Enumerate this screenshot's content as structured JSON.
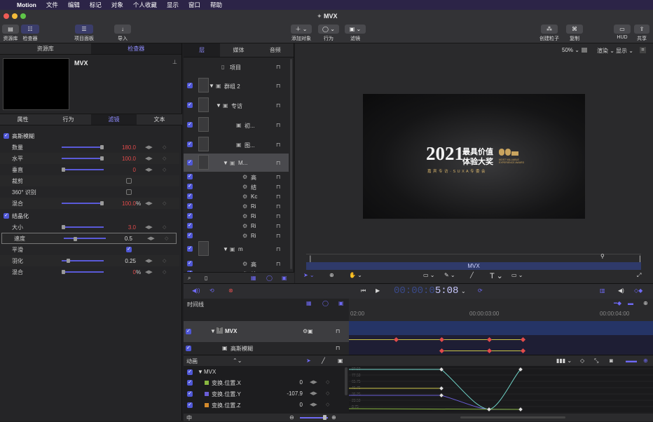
{
  "menubar": {
    "apple": "",
    "app": "Motion",
    "items": [
      "文件",
      "编辑",
      "标记",
      "对象",
      "个人收藏",
      "显示",
      "窗口",
      "帮助"
    ]
  },
  "window": {
    "title": "MVX"
  },
  "toolbar": {
    "library": "资源库",
    "inspector": "检查器",
    "project_panel": "项目面板",
    "import": "导入",
    "add_object": "添加对象",
    "behaviors": "行为",
    "filters": "滤镜",
    "make_particles": "创建粒子",
    "replicate": "复制",
    "hud": "HUD",
    "share": "共享"
  },
  "left_tabs": {
    "library": "资源库",
    "inspector": "检查器"
  },
  "inspector": {
    "preview_title": "MVX",
    "tabs": [
      "属性",
      "行为",
      "滤镜",
      "文本"
    ],
    "blur_section": "高斯模糊",
    "blur_params": [
      {
        "label": "数量",
        "value": "180.0",
        "unit": "",
        "fill": 0.97
      },
      {
        "label": "水平",
        "value": "100.0",
        "unit": "",
        "fill": 0.97
      },
      {
        "label": "垂直",
        "value": "0",
        "unit": "",
        "fill": 0.0
      },
      {
        "label": "裁剪",
        "value": "",
        "unit": ""
      },
      {
        "label": "360° 识别",
        "value": "",
        "unit": ""
      },
      {
        "label": "混合",
        "value": "100.0",
        "unit": "%",
        "fill": 0.97
      }
    ],
    "crystal_section": "结晶化",
    "crystal_params": [
      {
        "label": "大小",
        "value": "3.0",
        "unit": "",
        "fill": 0.0
      },
      {
        "label": "速度",
        "value": "0.5",
        "unit": "",
        "fill": 0.25
      },
      {
        "label": "平滑",
        "value": "",
        "unit": ""
      },
      {
        "label": "羽化",
        "value": "0.25",
        "unit": "",
        "fill": 0.12
      },
      {
        "label": "混合",
        "value": "0",
        "unit": "%",
        "fill": 0.0
      }
    ]
  },
  "layers": {
    "tabs": [
      "层",
      "媒体",
      "音频"
    ],
    "items": [
      {
        "label": "项目",
        "indent": 0
      },
      {
        "label": "群组 2",
        "indent": 1
      },
      {
        "label": "专访",
        "indent": 2
      },
      {
        "label": "初...",
        "indent": 3
      },
      {
        "label": "图...",
        "indent": 3
      },
      {
        "label": "M...",
        "indent": 3
      },
      {
        "label": "高",
        "indent": 4
      },
      {
        "label": "结",
        "indent": 4
      },
      {
        "label": "Kc",
        "indent": 4
      },
      {
        "label": "Ri",
        "indent": 4
      },
      {
        "label": "Ri",
        "indent": 4
      },
      {
        "label": "Ri",
        "indent": 4
      },
      {
        "label": "Ri",
        "indent": 4
      },
      {
        "label": "m",
        "indent": 3
      },
      {
        "label": "高",
        "indent": 4
      },
      {
        "label": "结",
        "indent": 4
      }
    ]
  },
  "canvas": {
    "zoom": "50%",
    "render": "渲染",
    "view": "显示",
    "viewer_year": "2021",
    "viewer_title1": "最具价值",
    "viewer_title2": "体验大奖",
    "viewer_sub": "嘉 宾 专 访 · S U X A 专 委 会",
    "viewer_logo_small": "MOST VALUABLE\nEXPERIENCE AWARD",
    "mini_label": "MVX"
  },
  "transport": {
    "timecode_prefix": "00:00:0",
    "timecode": "5:08"
  },
  "timeline": {
    "label": "时间线",
    "ruler": [
      "02:00",
      "00:00:03:00",
      "00:00:04:00"
    ],
    "tracks": [
      {
        "label": "MVX"
      },
      {
        "label": "高斯模糊"
      }
    ]
  },
  "animation": {
    "label": "动画",
    "root": "MVX",
    "params": [
      {
        "label": "变换.位置.X",
        "value": "0",
        "color": "#8ab840"
      },
      {
        "label": "变换.位置.Y",
        "value": "-107.9",
        "color": "#6a5ed8"
      },
      {
        "label": "变换.位置.Z",
        "value": "0",
        "color": "#d48a2c"
      }
    ],
    "y_ticks": [
      "87.50",
      "77.50",
      "65.75",
      "46.75",
      "36.25",
      "23.50",
      "8.75"
    ],
    "zoom_label": "中"
  }
}
